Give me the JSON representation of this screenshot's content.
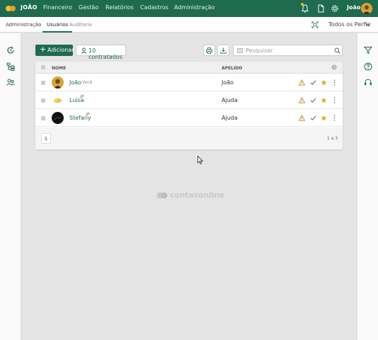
{
  "topbar": {
    "brand": "JOÃO",
    "nav": [
      "Financeiro",
      "Gestão",
      "Relatórios",
      "Cadastros",
      "Administração"
    ],
    "user_name": "João",
    "icons": [
      "bell-icon",
      "document-icon",
      "gear-icon"
    ]
  },
  "subbar": {
    "breadcrumb": "Administração",
    "tabs": [
      "Usuários",
      "Auditoria"
    ],
    "active_tab": "Usuários",
    "profile_filter": "Todos os Perfis"
  },
  "toolbar": {
    "add_label": "Adicionar",
    "contracted_label": "10 contratados",
    "search_placeholder": "Pesquisar"
  },
  "table": {
    "columns": [
      "NOME",
      "APELIDO"
    ],
    "rows": [
      {
        "name": "João",
        "badge": "Você",
        "nickname": "João",
        "pending": false
      },
      {
        "name": "Luisa",
        "badge": "",
        "nickname": "Ajuda",
        "pending": true
      },
      {
        "name": "Stefany",
        "badge": "",
        "nickname": "Ajuda",
        "pending": true
      }
    ],
    "page": "1",
    "page_info": "1 a 3"
  },
  "watermark": "contasonline",
  "colors": {
    "brand": "#1e6b50",
    "warning": "#c98a1b",
    "check": "#1e6b50",
    "star": "#e0b020"
  }
}
